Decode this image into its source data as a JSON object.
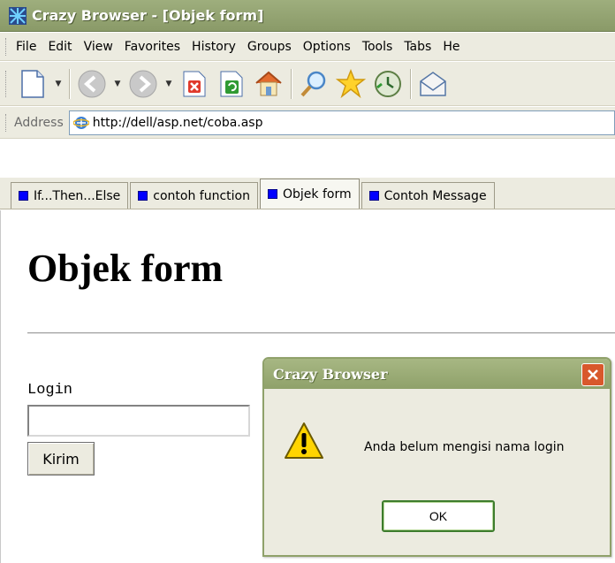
{
  "window": {
    "title": "Crazy Browser - [Objek form]"
  },
  "menu": {
    "items": [
      {
        "label": "File"
      },
      {
        "label": "Edit"
      },
      {
        "label": "View"
      },
      {
        "label": "Favorites"
      },
      {
        "label": "History"
      },
      {
        "label": "Groups"
      },
      {
        "label": "Options"
      },
      {
        "label": "Tools"
      },
      {
        "label": "Tabs"
      },
      {
        "label": "He"
      }
    ]
  },
  "address": {
    "label": "Address",
    "url": "http://dell/asp.net/coba.asp"
  },
  "tabs": [
    {
      "label": "If...Then...Else"
    },
    {
      "label": "contoh function"
    },
    {
      "label": "Objek form"
    },
    {
      "label": "Contoh Message"
    }
  ],
  "page": {
    "title": "Objek form",
    "login_label": "Login",
    "login_value": "",
    "submit_label": "Kirim"
  },
  "dialog": {
    "title": "Crazy Browser",
    "message": "Anda belum mengisi nama login",
    "ok_label": "OK"
  },
  "colors": {
    "tab_marker": "#0000ff",
    "title_bar": "#9eae7d",
    "dialog_close": "#d8582c"
  }
}
